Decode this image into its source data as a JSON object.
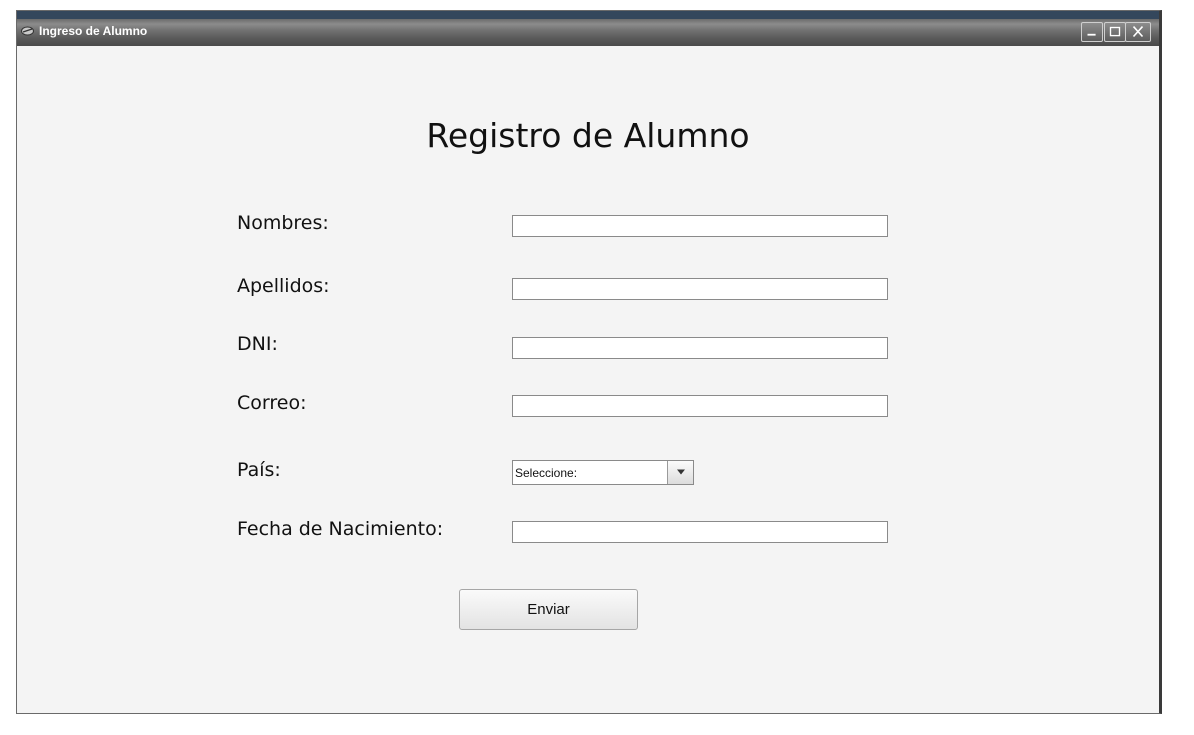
{
  "window": {
    "title": "Ingreso de Alumno",
    "controls": {
      "minimize": "minimize",
      "maximize": "maximize",
      "close": "close"
    }
  },
  "form": {
    "heading": "Registro de Alumno",
    "fields": {
      "nombres": {
        "label": "Nombres:",
        "value": ""
      },
      "apellidos": {
        "label": "Apellidos:",
        "value": ""
      },
      "dni": {
        "label": "DNI:",
        "value": ""
      },
      "correo": {
        "label": "Correo:",
        "value": ""
      },
      "pais": {
        "label": "País:",
        "selected": "Seleccione:"
      },
      "fecha": {
        "label": "Fecha de Nacimiento:",
        "value": ""
      }
    },
    "submit_label": "Enviar"
  },
  "icons": {
    "app": "app-icon",
    "dropdown": "chevron-down-icon"
  },
  "colors": {
    "titlebar": "#4a4a4a",
    "panel": "#f4f4f4"
  }
}
